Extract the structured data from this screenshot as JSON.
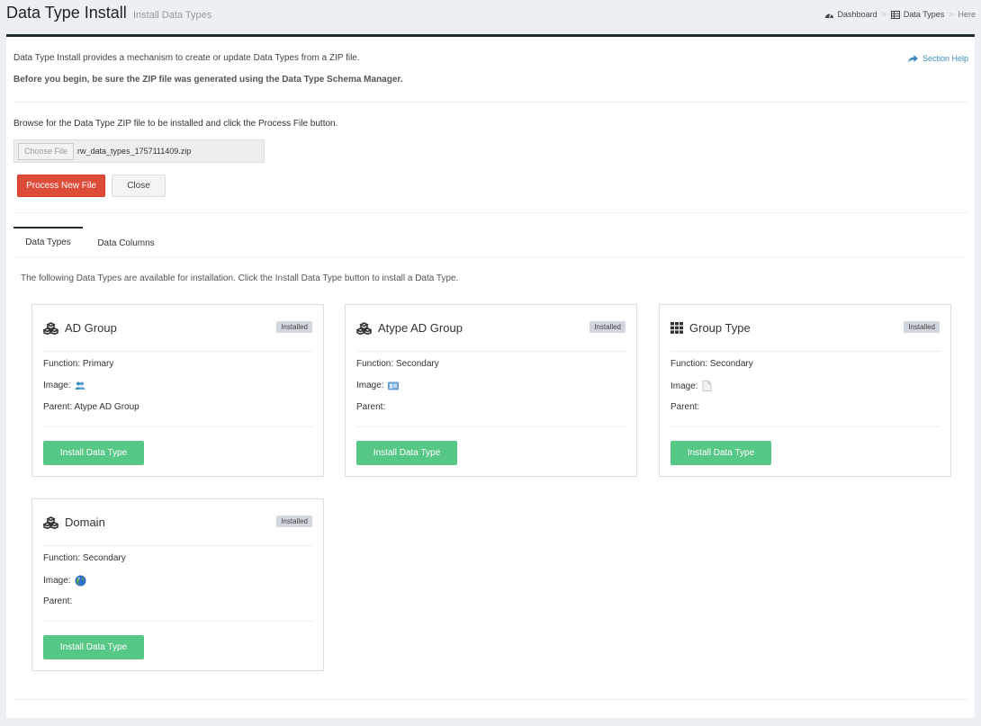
{
  "header": {
    "title": "Data Type Install",
    "subtitle": "Install Data Types",
    "breadcrumb": [
      {
        "label": "Dashboard",
        "icon": "tachometer-icon"
      },
      {
        "label": "Data Types",
        "icon": "table-icon"
      },
      {
        "label": "Here"
      }
    ],
    "separator": ">"
  },
  "intro": {
    "text": "Data Type Install provides a mechanism to create or update Data Types from a ZIP file.",
    "warning": "Before you begin, be sure the ZIP file was generated using the Data Type Schema Manager.",
    "help_label": "Section Help"
  },
  "upload": {
    "instructions": "Browse for the Data Type ZIP file to be installed and click the Process File button.",
    "choose_label": "Choose File",
    "file_name": "rw_data_types_1757111409.zip",
    "process_label": "Process New File",
    "close_label": "Close"
  },
  "tabs": [
    {
      "label": "Data Types",
      "active": true
    },
    {
      "label": "Data Columns",
      "active": false
    }
  ],
  "tab_description": "The following Data Types are available for installation. Click the Install Data Type button to install a Data Type.",
  "cards": [
    {
      "name": "AD Group",
      "icon": "cubes-icon",
      "status": "Installed",
      "function_line": "Function: Primary",
      "image_label": "Image:",
      "image_icon": "users-icon",
      "parent_line": "Parent: Atype AD Group",
      "install_label": "Install Data Type"
    },
    {
      "name": "Atype AD Group",
      "icon": "cubes-icon",
      "status": "Installed",
      "function_line": "Function: Secondary",
      "image_label": "Image:",
      "image_icon": "id-card-icon",
      "parent_line": "Parent:",
      "install_label": "Install Data Type"
    },
    {
      "name": "Group Type",
      "icon": "grid-icon",
      "status": "Installed",
      "function_line": "Function: Secondary",
      "image_label": "Image:",
      "image_icon": "document-icon",
      "parent_line": "Parent:",
      "install_label": "Install Data Type"
    },
    {
      "name": "Domain",
      "icon": "cubes-icon",
      "status": "Installed",
      "function_line": "Function: Secondary",
      "image_label": "Image:",
      "image_icon": "globe-icon",
      "parent_line": "Parent:",
      "install_label": "Install Data Type"
    }
  ],
  "colors": {
    "accent": "#3c8dbc",
    "danger": "#dd4b39",
    "success": "#57c785",
    "badge": "#d2d6de",
    "background": "#ecf0f5"
  }
}
